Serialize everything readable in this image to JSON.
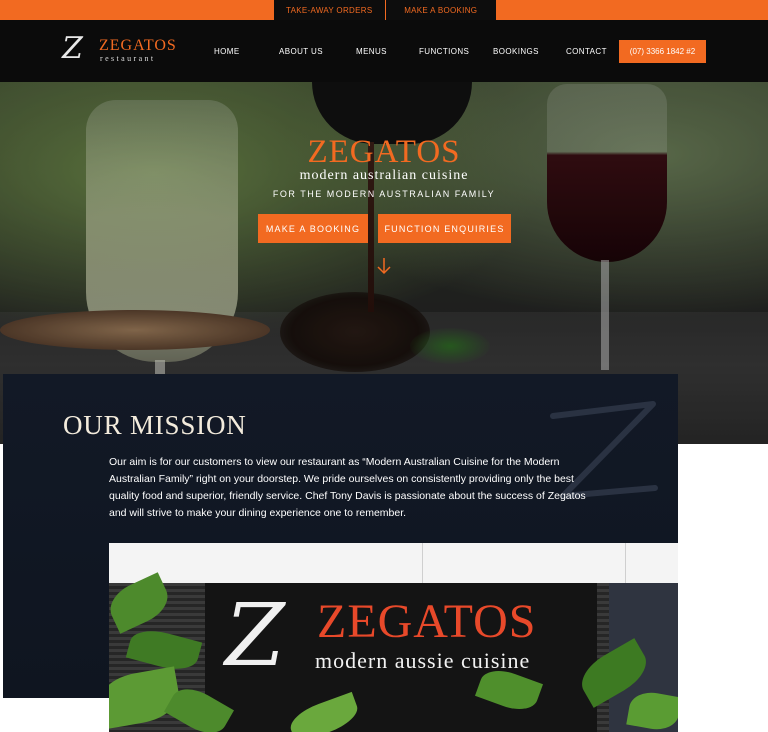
{
  "topbar": {
    "links": [
      "TAKE-AWAY ORDERS",
      "MAKE A BOOKING"
    ]
  },
  "brand": {
    "logo_letter": "Z",
    "name": "ZEGATOS",
    "sub": "restaurant"
  },
  "nav": {
    "items": [
      "HOME",
      "ABOUT US",
      "MENUS",
      "FUNCTIONS",
      "BOOKINGS",
      "CONTACT"
    ],
    "phone": "(07) 3366 1842 #2"
  },
  "hero": {
    "title": "ZEGATOS",
    "subtitle": "modern australian cuisine",
    "tagline": "FOR THE MODERN AUSTRALIAN FAMILY",
    "buttons": [
      "MAKE A BOOKING",
      "FUNCTION ENQUIRIES"
    ],
    "scroll_icon": "arrow-down-icon"
  },
  "mission": {
    "title": "OUR MISSION",
    "body": "Our aim is for our customers to view our restaurant as “Modern Australian Cuisine for the Modern Australian Family” right on your doorstep. We pride ourselves on consistently providing only the best quality food and superior, friendly service. Chef Tony Davis is passionate about the success of Zegatos and will strive to make your dining experience one to remember."
  },
  "sign": {
    "letter": "Z",
    "name": "ZEGATOS",
    "sub": "modern aussie cuisine"
  },
  "colors": {
    "accent": "#f26a21",
    "nav_bg": "#0b0b0b",
    "mission_bg": "#121926",
    "mission_title": "#f3ebdc"
  }
}
